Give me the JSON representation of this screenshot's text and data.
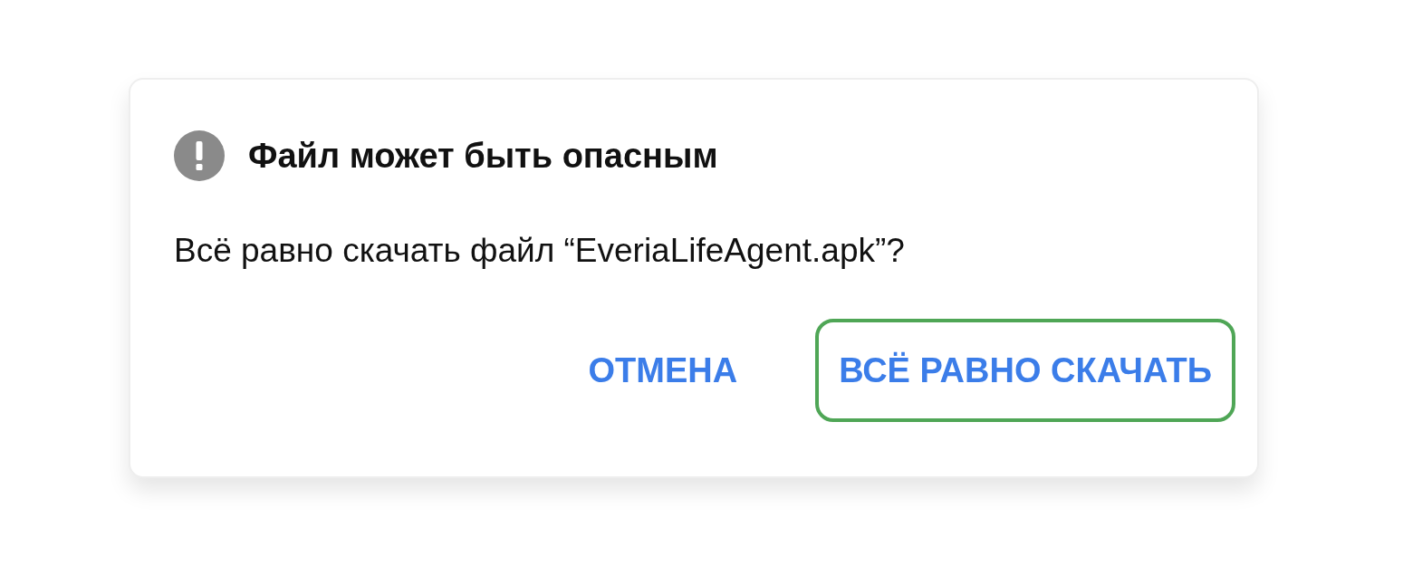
{
  "dialog": {
    "title": "Файл может быть опасным",
    "message": "Всё равно скачать файл “EveriaLifeAgent.apk”?",
    "buttons": [
      {
        "label": "ОТМЕНА",
        "selected": false
      },
      {
        "label": "ВСЁ РАВНО СКАЧАТЬ",
        "selected": true
      }
    ]
  }
}
